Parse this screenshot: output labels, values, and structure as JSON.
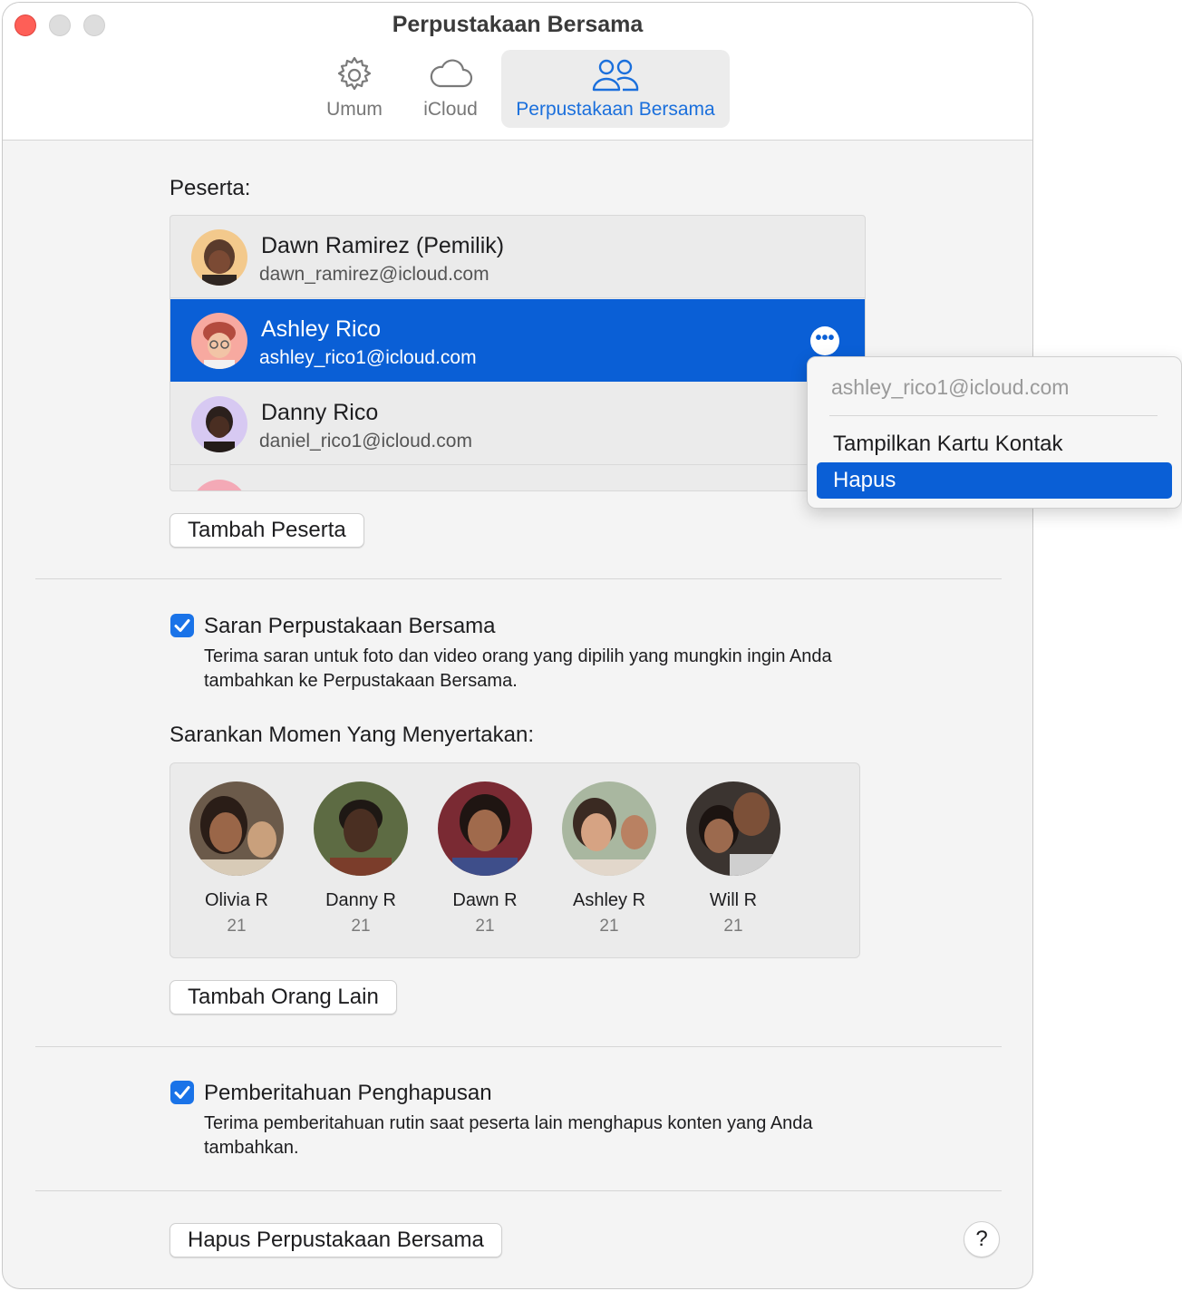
{
  "window": {
    "title": "Perpustakaan Bersama"
  },
  "toolbar": {
    "tabs": [
      {
        "label": "Umum",
        "icon": "gear-icon"
      },
      {
        "label": "iCloud",
        "icon": "cloud-icon"
      },
      {
        "label": "Perpustakaan Bersama",
        "icon": "people-icon",
        "active": true
      }
    ]
  },
  "participants": {
    "label": "Peserta:",
    "rows": [
      {
        "name": "Dawn Ramirez (Pemilik)",
        "email": "dawn_ramirez@icloud.com"
      },
      {
        "name": "Ashley Rico",
        "email": "ashley_rico1@icloud.com",
        "selected": true
      },
      {
        "name": "Danny Rico",
        "email": "daniel_rico1@icloud.com"
      }
    ],
    "more_glyph": "•••",
    "add_button": "Tambah Peserta"
  },
  "context_menu": {
    "header": "ashley_rico1@icloud.com",
    "items": [
      {
        "label": "Tampilkan Kartu Kontak"
      },
      {
        "label": "Hapus",
        "highlighted": true
      }
    ]
  },
  "suggestions": {
    "checkbox_title": "Saran Perpustakaan Bersama",
    "checked": true,
    "description": "Terima saran untuk foto dan video orang yang dipilih yang mungkin ingin Anda tambahkan ke Perpustakaan Bersama."
  },
  "moments": {
    "label": "Sarankan Momen Yang Menyertakan:",
    "people": [
      {
        "name": "Olivia R",
        "count": "21"
      },
      {
        "name": "Danny R",
        "count": "21"
      },
      {
        "name": "Dawn R",
        "count": "21"
      },
      {
        "name": "Ashley R",
        "count": "21"
      },
      {
        "name": "Will R",
        "count": "21"
      }
    ],
    "add_button": "Tambah Orang Lain"
  },
  "deletion": {
    "checkbox_title": "Pemberitahuan Penghapusan",
    "checked": true,
    "description": "Terima pemberitahuan rutin saat peserta lain menghapus konten yang Anda tambahkan."
  },
  "footer": {
    "delete_button": "Hapus Perpustakaan Bersama",
    "help": "?"
  },
  "colors": {
    "accent": "#0a5fd6",
    "checkbox": "#1a73e8",
    "close": "#fe5f57"
  }
}
